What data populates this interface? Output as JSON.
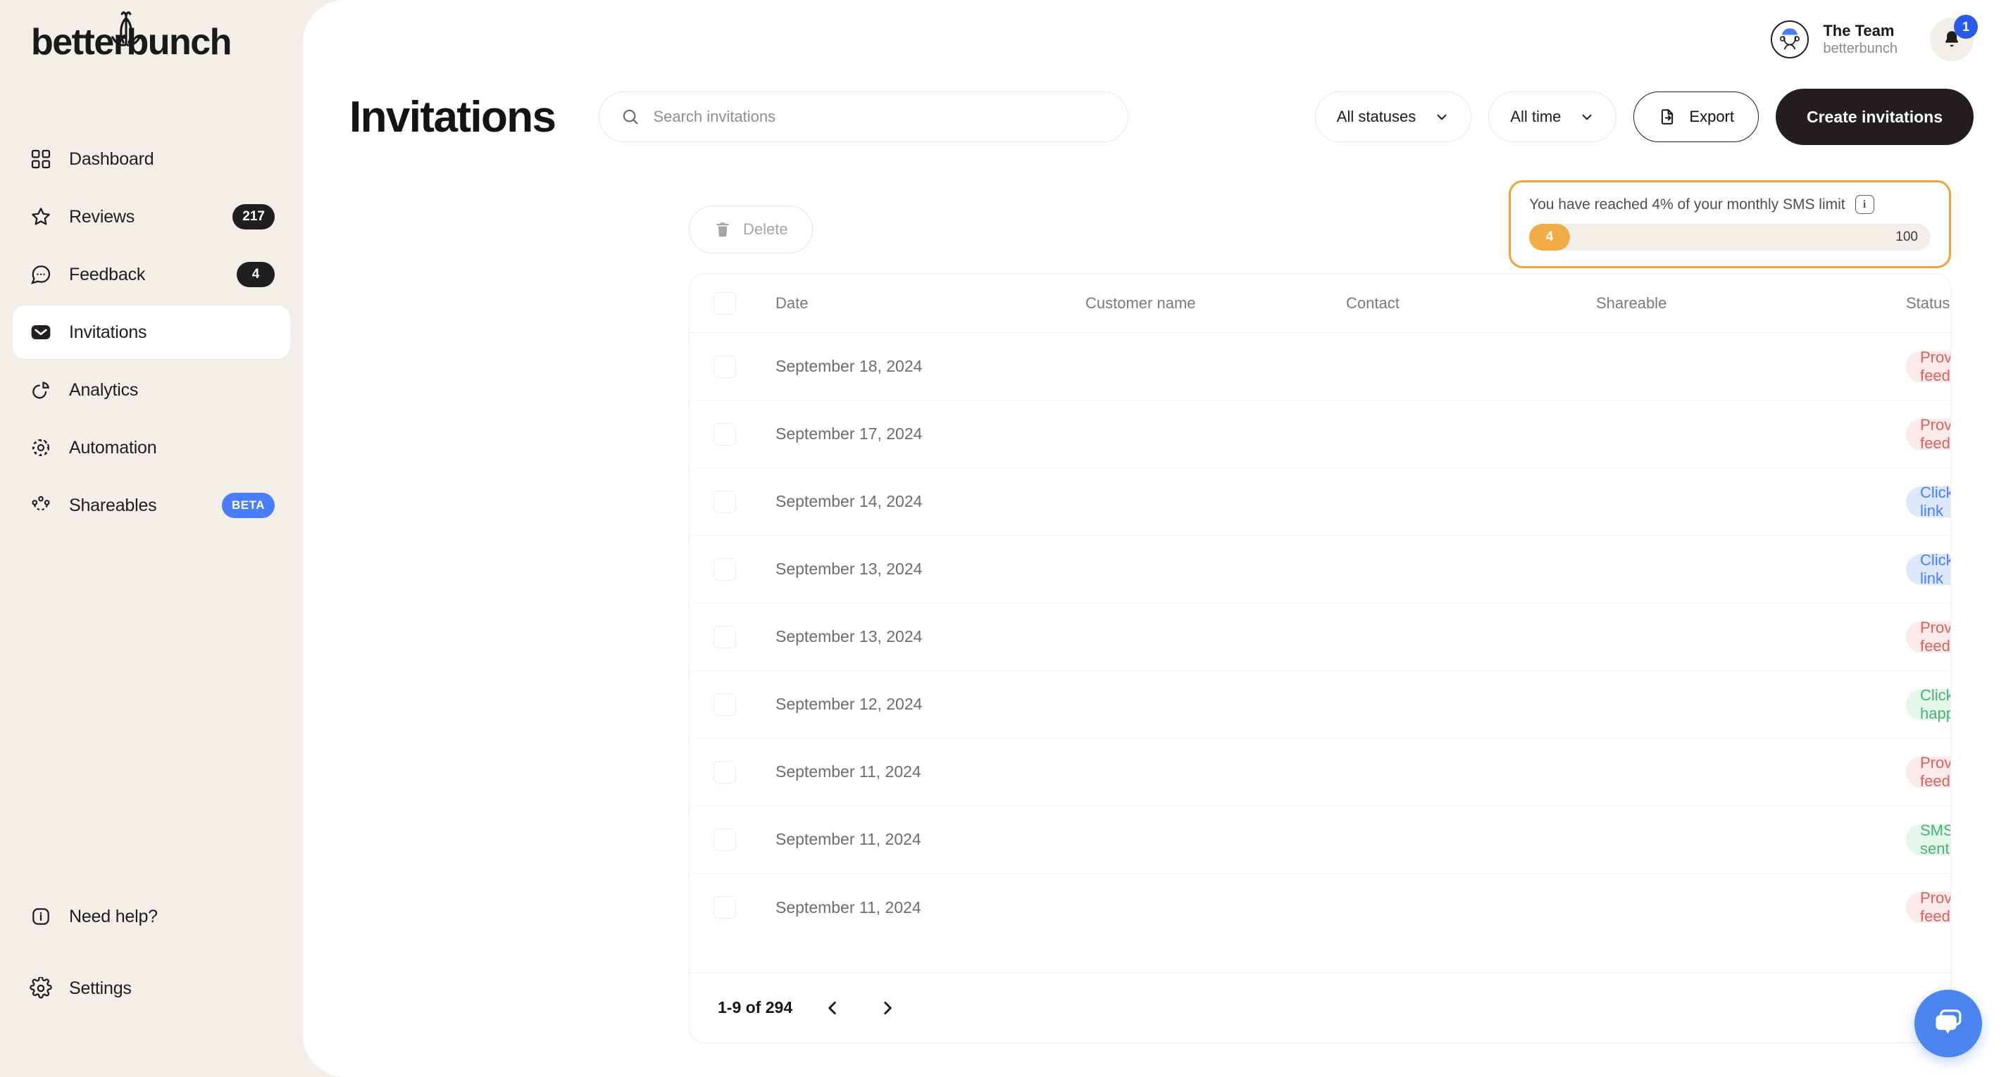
{
  "brand": {
    "name": "betterbunch",
    "logo_icon": "bee-icon"
  },
  "sidebar": {
    "items": [
      {
        "label": "Dashboard",
        "icon": "grid-icon",
        "badge": null,
        "active": false
      },
      {
        "label": "Reviews",
        "icon": "star-icon",
        "badge": "217",
        "active": false
      },
      {
        "label": "Feedback",
        "icon": "chat-icon",
        "badge": "4",
        "active": false
      },
      {
        "label": "Invitations",
        "icon": "envelope-icon",
        "badge": null,
        "active": true
      },
      {
        "label": "Analytics",
        "icon": "pie-chart-icon",
        "badge": null,
        "active": false
      },
      {
        "label": "Automation",
        "icon": "gear-loop-icon",
        "badge": null,
        "active": false
      },
      {
        "label": "Shareables",
        "icon": "share-icon",
        "badge": "BETA",
        "active": false
      }
    ],
    "bottom_items": [
      {
        "label": "Need help?",
        "icon": "info-icon"
      },
      {
        "label": "Settings",
        "icon": "gear-icon"
      }
    ]
  },
  "topbar": {
    "user_name": "The Team",
    "user_org": "betterbunch",
    "avatar_icon": "person-avatar",
    "bell_icon": "bell-icon",
    "notification_count": "1"
  },
  "header": {
    "title": "Invitations",
    "search": {
      "placeholder": "Search invitations",
      "value": "",
      "icon": "search-icon"
    },
    "status_filter": {
      "label": "All statuses",
      "icon": "chevron-down-icon"
    },
    "time_filter": {
      "label": "All time",
      "icon": "chevron-down-icon"
    },
    "export_button": {
      "label": "Export",
      "icon": "export-file-icon"
    },
    "create_button": {
      "label": "Create invitations"
    }
  },
  "actions": {
    "delete_button": {
      "label": "Delete",
      "icon": "trash-icon",
      "disabled": true
    }
  },
  "sms_limit": {
    "message": "You have reached 4% of your monthly SMS limit",
    "info_icon": "info-icon",
    "used": "4",
    "max": "100",
    "percent": 4,
    "border_color": "#f0a03c",
    "fill_color": "#f0ad45"
  },
  "table": {
    "columns": [
      "Date",
      "Customer name",
      "Contact",
      "Shareable",
      "Status"
    ],
    "status_info_icon": "info-icon",
    "rows": [
      {
        "date": "September 18, 2024",
        "customer": "",
        "contact": "",
        "shareable": "",
        "status": "Provided feedback",
        "status_tone": "red"
      },
      {
        "date": "September 17, 2024",
        "customer": "",
        "contact": "",
        "shareable": "",
        "status": "Provided feedback",
        "status_tone": "red"
      },
      {
        "date": "September 14, 2024",
        "customer": "",
        "contact": "",
        "shareable": "",
        "status": "Clicked link",
        "status_tone": "blue"
      },
      {
        "date": "September 13, 2024",
        "customer": "",
        "contact": "",
        "shareable": "",
        "status": "Clicked link",
        "status_tone": "blue"
      },
      {
        "date": "September 13, 2024",
        "customer": "",
        "contact": "",
        "shareable": "",
        "status": "Provided feedback",
        "status_tone": "red"
      },
      {
        "date": "September 12, 2024",
        "customer": "",
        "contact": "",
        "shareable": "",
        "status": "Clicked happy",
        "status_tone": "green"
      },
      {
        "date": "September 11, 2024",
        "customer": "",
        "contact": "",
        "shareable": "",
        "status": "Provided feedback",
        "status_tone": "red"
      },
      {
        "date": "September 11, 2024",
        "customer": "",
        "contact": "",
        "shareable": "",
        "status": "SMS sent",
        "status_tone": "green"
      },
      {
        "date": "September 11, 2024",
        "customer": "",
        "contact": "",
        "shareable": "",
        "status": "Provided feedback",
        "status_tone": "red"
      }
    ]
  },
  "pagination": {
    "range_label": "1-9 of 294",
    "prev_icon": "chevron-left-icon",
    "next_icon": "chevron-right-icon"
  },
  "chat_widget": {
    "icon": "chat-bubbles-icon",
    "color": "#4a85f0"
  },
  "colors": {
    "sidebar_bg": "#f2efe9",
    "accent_blue": "#4a7dfb",
    "dark": "#231f20",
    "warning": "#f0a03c"
  }
}
